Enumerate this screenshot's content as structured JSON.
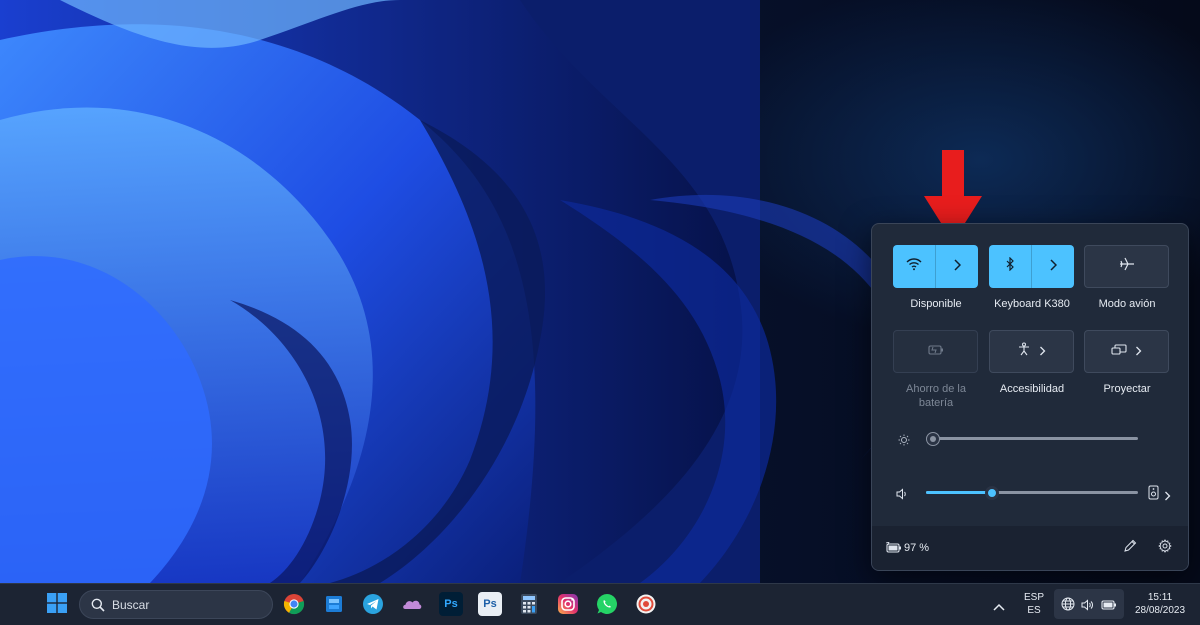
{
  "quick_settings": {
    "tiles": [
      {
        "id": "wifi",
        "label": "Disponible",
        "state": "on",
        "icon": "wifi-icon",
        "has_chevron": true
      },
      {
        "id": "bluetooth",
        "label": "Keyboard K380",
        "state": "on",
        "icon": "bluetooth-icon",
        "has_chevron": true
      },
      {
        "id": "airplane",
        "label": "Modo avión",
        "state": "off",
        "icon": "airplane-icon",
        "has_chevron": false
      },
      {
        "id": "battery_saver",
        "label_line1": "Ahorro de la",
        "label_line2": "batería",
        "state": "disabled",
        "icon": "battery-saver-icon",
        "has_chevron": false
      },
      {
        "id": "accessibility",
        "label": "Accesibilidad",
        "state": "off",
        "icon": "accessibility-icon",
        "has_chevron": true
      },
      {
        "id": "project",
        "label": "Proyectar",
        "state": "off",
        "icon": "project-icon",
        "has_chevron": true
      }
    ],
    "brightness_level": 0.0,
    "volume_level": 0.3,
    "battery_text": "97 %",
    "accent_color": "#4cc2ff"
  },
  "taskbar": {
    "search_placeholder": "Buscar",
    "pinned_apps": [
      "start-icon",
      "chrome-icon",
      "files-icon",
      "telegram-icon",
      "onedrive-icon",
      "photoshop-icon",
      "photoshop-elements-icon",
      "calculator-icon",
      "instagram-icon",
      "whatsapp-icon",
      "screen-recorder-icon"
    ],
    "ps_label": "Ps",
    "language_line1": "ESP",
    "language_line2": "ES",
    "time": "15:11",
    "date": "28/08/2023"
  }
}
